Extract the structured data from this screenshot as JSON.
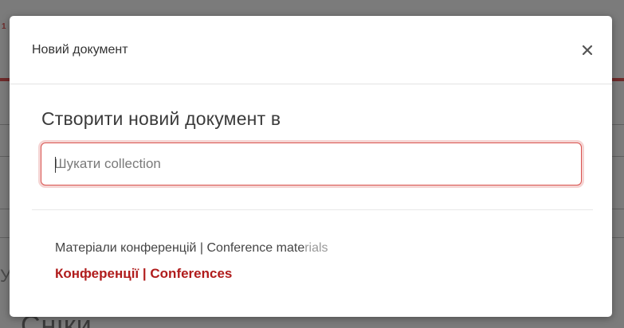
{
  "background": {
    "heading_fragment": "Сніки",
    "side_fragment": "1",
    "mid_fragment": "У"
  },
  "modal": {
    "title": "Новий документ",
    "close_symbol": "×",
    "prompt": "Створити новий документ в",
    "search": {
      "placeholder": "Шукати collection",
      "value": ""
    },
    "results": {
      "parent_label_main": "Матеріали конференцій | Conference mate",
      "parent_label_faded": "rials",
      "child_label": "Конференції | Conferences"
    }
  },
  "colors": {
    "accent": "#b01c1c",
    "input_border": "#d9534f"
  }
}
